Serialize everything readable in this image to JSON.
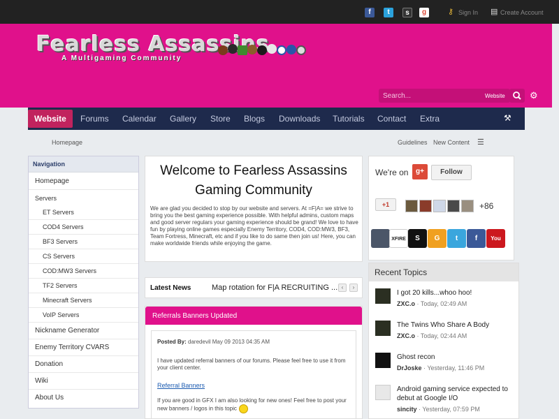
{
  "topbar": {
    "social_icons": [
      "facebook-icon",
      "twitter-icon",
      "steam-icon",
      "google-icon"
    ],
    "sign_in": "Sign In",
    "create_account": "Create Account"
  },
  "header": {
    "logo_title": "Fearless Assassins",
    "logo_subtitle": "A Multigaming Community",
    "search": {
      "placeholder": "Search...",
      "scope": "Website"
    },
    "accent_color": "#e0118b"
  },
  "nav": {
    "items": [
      "Website",
      "Forums",
      "Calendar",
      "Gallery",
      "Store",
      "Blogs",
      "Downloads",
      "Tutorials",
      "Contact",
      "Extra"
    ],
    "active": "Website"
  },
  "breadcrumb": {
    "home": "Homepage",
    "guidelines": "Guidelines",
    "new_content": "New Content"
  },
  "sidebar": {
    "heading": "Navigation",
    "items": {
      "homepage": "Homepage",
      "servers": "Servers",
      "et": "ET Servers",
      "cod4": "COD4 Servers",
      "bf3": "BF3 Servers",
      "cs": "CS Servers",
      "codmw3": "COD:MW3 Servers",
      "tf2": "TF2 Servers",
      "minecraft": "Minecraft Servers",
      "voip": "VoIP Servers",
      "nickname": "Nickname Generator",
      "cvars": "Enemy Territory CVARS",
      "donation": "Donation",
      "wiki": "Wiki",
      "about": "About Us"
    }
  },
  "welcome": {
    "title": "Welcome to Fearless Assassins Gaming Community",
    "text": "We are glad you decided to stop by our website and servers. At =F|A= we strive to bring you the best gaming experience possible. With helpful admins, custom maps and good server regulars your gaming experience should be grand! We love to have fun by playing online games especially Enemy Territory, COD4, COD:MW3, BF3, Team Fortress, Minecraft, etc and if you like to do same then join us! Here, you can make worldwide friends while enjoying the game."
  },
  "latest_news": {
    "label": "Latest News",
    "item": "Map rotation for F|A RECRUITING ..."
  },
  "article": {
    "title": "Referrals Banners Updated",
    "posted_by_label": "Posted By:",
    "author": "daredevil",
    "date": "May 09 2013 04:35 AM",
    "para1": "I have updated referral banners of our forums. Please feel free to use it from your client center.",
    "link": "Referral Banners",
    "para2": "If you are good in GFX I am also looking for new ones! Feel free to post your new banners / logos in this topic"
  },
  "gplus": {
    "label": "We're on",
    "follow": "Follow",
    "plus_one": "+1",
    "count": "+86"
  },
  "community_icons": [
    "xfire-icon",
    "steam-icon",
    "gamer-icon",
    "twitter-icon",
    "facebook-icon",
    "youtube-icon"
  ],
  "recent_topics": {
    "heading": "Recent Topics",
    "items": [
      {
        "title": "I got 20 kills...whoo hoo!",
        "author": "ZXC.o",
        "time": "Today, 02:49 AM"
      },
      {
        "title": "The Twins Who Share A Body",
        "author": "ZXC.o",
        "time": "Today, 02:44 AM"
      },
      {
        "title": "Ghost recon",
        "author": "DrJoske",
        "time": "Yesterday, 11:46 PM"
      },
      {
        "title": "Android gaming service expected to debut at Google I/O",
        "author": "sincity",
        "time": "Yesterday, 07:59 PM"
      }
    ]
  }
}
